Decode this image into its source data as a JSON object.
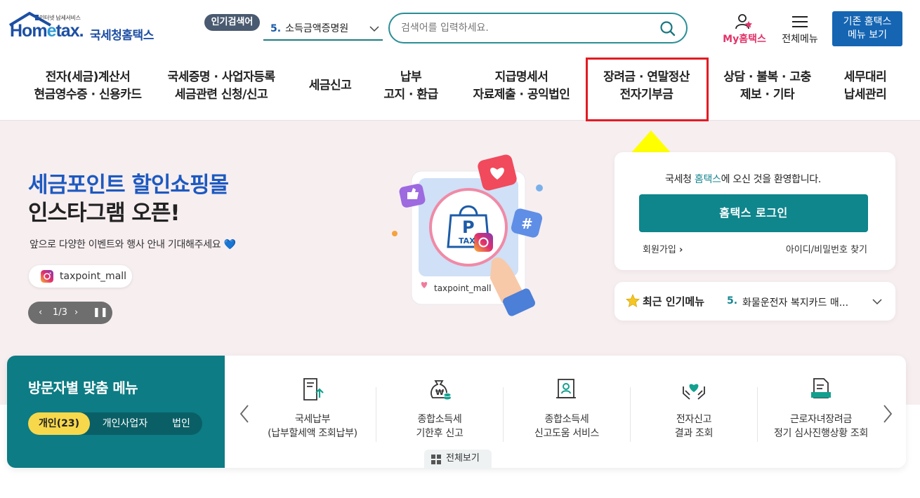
{
  "header": {
    "logo": {
      "tagline": "인터넷 납세서비스",
      "brand_pre": "Hom",
      "brand_e": "e",
      "brand_post": "tax.",
      "name": "국세청홈택스"
    },
    "popular": {
      "badge": "인기검색어",
      "rank": "5.",
      "term": "소득금액증명원"
    },
    "search": {
      "placeholder": "검색어를 입력하세요."
    },
    "my_home": "My홈택스",
    "all_menu": "전체메뉴",
    "old_menu": {
      "line1": "기존 홈택스",
      "line2": "메뉴 보기"
    }
  },
  "gnb": [
    {
      "line1": "전자(세금)계산서",
      "line2": "현금영수증 · 신용카드"
    },
    {
      "line1": "국세증명 · 사업자등록",
      "line2": "세금관련 신청/신고"
    },
    {
      "line1": "세금신고",
      "line2": ""
    },
    {
      "line1": "납부",
      "line2": "고지 · 환급"
    },
    {
      "line1": "지급명세서",
      "line2": "자료제출 · 공익법인"
    },
    {
      "line1": "장려금 · 연말정산",
      "line2": "전자기부금"
    },
    {
      "line1": "상담 · 불복 · 고충",
      "line2": "제보 · 기타"
    },
    {
      "line1": "세무대리",
      "line2": "납세관리"
    }
  ],
  "hero": {
    "title1": "세금포인트 할인쇼핑몰",
    "title2": "인스타그램 오픈!",
    "subtitle": "앞으로 다양한 이벤트와 행사 안내 기대해주세요 💙",
    "tag": "taxpoint_mall",
    "card_tag": "taxpoint_mall",
    "bag_letter": "P",
    "bag_text": "TAX",
    "pager": {
      "prev": "‹",
      "count": "1/3",
      "next": "›",
      "pause": "❚❚"
    }
  },
  "login": {
    "welcome_pre": "국세청 ",
    "welcome_hl": "홈택스",
    "welcome_post": "에 오신 것을 환영합니다.",
    "button": "홈택스 로그인",
    "signup": "회원가입",
    "find": "아이디/비밀번호 찾기"
  },
  "recent": {
    "title": "최근 인기메뉴",
    "rank": "5.",
    "value": "화물운전자 복지카드 매..."
  },
  "visitor": {
    "title": "방문자별 맞춤 메뉴",
    "tabs": [
      "개인(23)",
      "개인사업자",
      "법인"
    ],
    "items": [
      {
        "l1": "국세납부",
        "l2": "(납부할세액 조회납부)",
        "icon": "tax-payment-icon"
      },
      {
        "l1": "종합소득세",
        "l2": "기한후 신고",
        "icon": "money-bag-icon"
      },
      {
        "l1": "종합소득세",
        "l2": "신고도움 서비스",
        "icon": "certificate-icon"
      },
      {
        "l1": "전자신고",
        "l2": "결과 조회",
        "icon": "heart-hands-icon"
      },
      {
        "l1": "근로자녀장려금",
        "l2": "정기 심사진행상황 조회",
        "icon": "document-icon"
      }
    ],
    "view_all": "전체보기"
  },
  "colors": {
    "brand_blue": "#1d4fa3",
    "teal": "#0f858c",
    "highlight_red": "#e31b23",
    "arrow_yellow": "#ffff00"
  }
}
